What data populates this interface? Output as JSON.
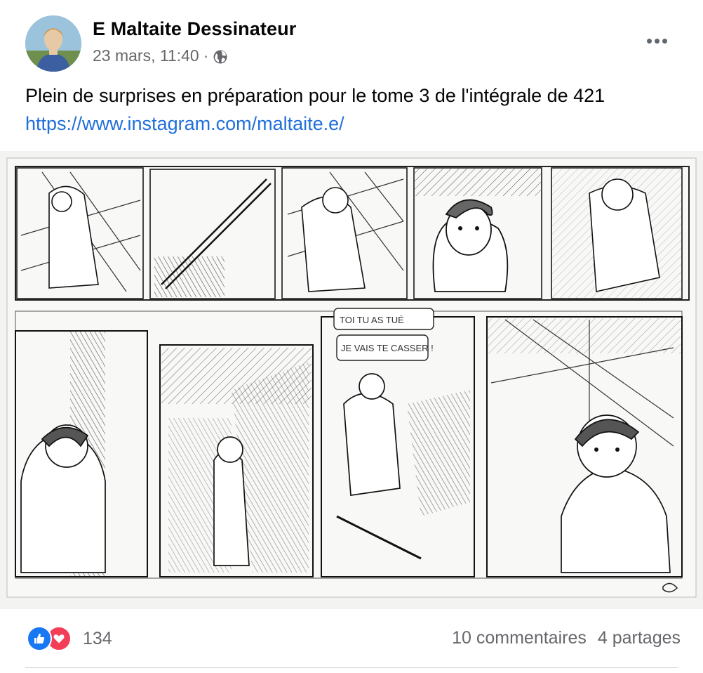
{
  "post": {
    "author": "E Maltaite Dessinateur",
    "date": "23 mars, 11:40",
    "separator": "·",
    "privacy_icon": "globe-icon",
    "more_icon": "more-options-icon",
    "text_main": "Plein de surprises en préparation pour le tome 3 de l'intégrale de 421 ",
    "link": "https://www.instagram.com/maltaite.e/",
    "image": {
      "kind": "pencil comic page sketch",
      "speech_bubble_1": "TOI TU AS TUÉ",
      "speech_bubble_2": "JE VAIS TE CASSER !"
    }
  },
  "footer": {
    "reaction_icons": [
      "like-icon",
      "love-icon"
    ],
    "reaction_count": "134",
    "comments": "10 commentaires",
    "shares": "4 partages"
  },
  "colors": {
    "link": "#216fdb",
    "secondary_text": "#65676b",
    "like": "#1877f2",
    "love": "#f33e58"
  }
}
